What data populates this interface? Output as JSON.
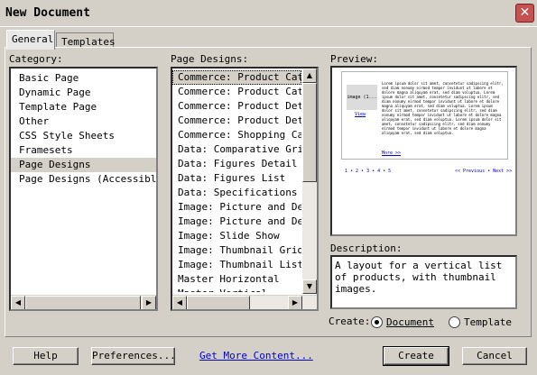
{
  "window": {
    "title": "New Document",
    "close": "✕"
  },
  "tabs": [
    {
      "label": "General"
    },
    {
      "label": "Templates"
    }
  ],
  "category": {
    "label": "Category:",
    "items": [
      "Basic Page",
      "Dynamic Page",
      "Template Page",
      "Other",
      "CSS Style Sheets",
      "Framesets",
      "Page Designs",
      "Page Designs (Accessible)"
    ],
    "selected": "Page Designs"
  },
  "designs": {
    "label": "Page Designs:",
    "items": [
      "Commerce: Product Catal",
      "Commerce: Product Catal",
      "Commerce: Product Detai",
      "Commerce: Product Detai",
      "Commerce: Shopping Cart",
      "Data: Comparative Grid",
      "Data: Figures Detail",
      "Data: Figures List",
      "Data: Specifications",
      "Image: Picture and Desc",
      "Image: Picture and Desc",
      "Image: Slide Show",
      "Image: Thumbnail Grid",
      "Image: Thumbnail List",
      "Master Horizontal",
      "Master Vertical"
    ]
  },
  "preview": {
    "label": "Preview:",
    "image_label": "image (1...",
    "view_link": "View",
    "more_link": "More >>",
    "pager": "1 • 2 • 3 • 4 • 5",
    "pager_nav": "<< Previous • Next >>",
    "lorem": "Lorem ipsum dolor sit amet, consetetur sadipscing elitr, sed diam nonumy eirmod tempor invidunt ut labore et dolore magna aliquyam erat, sed diam voluptua. Lorem ipsum dolor sit amet, consetetur sadipscing elitr, sed diam nonumy eirmod tempor invidunt ut labore et dolore magna aliquyam erat, sed diam voluptua. Lorem ipsum dolor sit amet, consetetur sadipscing elitr, sed diam nonumy eirmod tempor invidunt ut labore et dolore magna aliquyam erat, sed diam voluptua. Lorem ipsum dolor sit amet, consetetur sadipscing elitr, sed diam nonumy eirmod tempor invidunt ut labore et dolore magna aliquyam erat, sed diam voluptua."
  },
  "description": {
    "label": "Description:",
    "text": "A layout for a vertical list of products, with thumbnail images."
  },
  "create": {
    "label": "Create:",
    "options": [
      "Document",
      "Template"
    ],
    "selected": "Document"
  },
  "buttons": {
    "help": "Help",
    "preferences": "Preferences...",
    "get_more": "Get More Content...",
    "create": "Create",
    "cancel": "Cancel"
  }
}
